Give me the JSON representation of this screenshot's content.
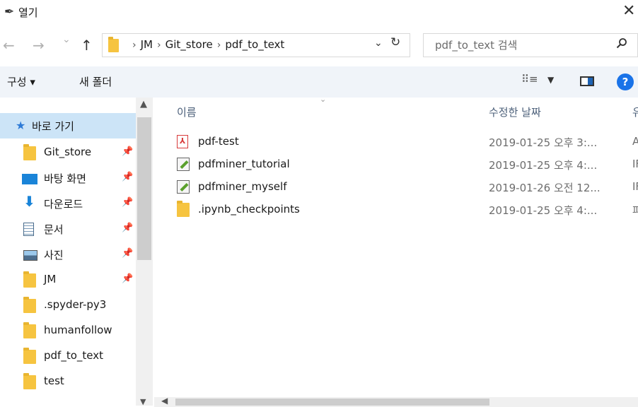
{
  "window": {
    "title": "열기",
    "close_glyph": "✕"
  },
  "nav": {
    "back_glyph": "←",
    "forward_glyph": "→",
    "recent_glyph": "⌄",
    "up_glyph": "↑",
    "breadcrumbs": [
      "JM",
      "Git_store",
      "pdf_to_text"
    ],
    "crumb_sep": "›",
    "dropdown_glyph": "⌄",
    "refresh_glyph": "↻",
    "search_placeholder": "pdf_to_text 검색",
    "search_glyph": "⚲"
  },
  "toolbar": {
    "organize_label": "구성 ▾",
    "new_folder_label": "새 폴더",
    "view_glyph": "⠿≡",
    "view_dropdown_glyph": "▼",
    "help_glyph": "?"
  },
  "sidebar": {
    "quick_access_label": "바로 가기",
    "items": [
      {
        "label": "Git_store",
        "icon": "folder-icon",
        "pinned": true
      },
      {
        "label": "바탕 화면",
        "icon": "desktop-icon",
        "pinned": true
      },
      {
        "label": "다운로드",
        "icon": "download-icon",
        "pinned": true
      },
      {
        "label": "문서",
        "icon": "document-icon",
        "pinned": true
      },
      {
        "label": "사진",
        "icon": "pictures-icon",
        "pinned": true
      },
      {
        "label": "JM",
        "icon": "folder-icon",
        "pinned": true
      },
      {
        "label": ".spyder-py3",
        "icon": "folder-icon",
        "pinned": false
      },
      {
        "label": "humanfollow",
        "icon": "folder-icon",
        "pinned": false
      },
      {
        "label": "pdf_to_text",
        "icon": "folder-icon",
        "pinned": false
      },
      {
        "label": "test",
        "icon": "folder-icon",
        "pinned": false
      }
    ],
    "pin_glyph": "✦"
  },
  "columns": {
    "name": "이름",
    "date": "수정한 날짜",
    "type": "유"
  },
  "files": [
    {
      "name": "pdf-test",
      "date": "2019-01-25 오후 3:...",
      "type": "A",
      "icon": "pdf-icon"
    },
    {
      "name": "pdfminer_tutorial",
      "date": "2019-01-25 오후 4:...",
      "type": "IF",
      "icon": "notebook-icon"
    },
    {
      "name": "pdfminer_myself",
      "date": "2019-01-26 오전 12...",
      "type": "IF",
      "icon": "notebook-icon"
    },
    {
      "name": ".ipynb_checkpoints",
      "date": "2019-01-25 오후 4:...",
      "type": "파",
      "icon": "folder-icon"
    }
  ],
  "colors": {
    "accent": "#1a73e8",
    "selection": "#cce4f7",
    "toolbar_bg": "#f0f4f9",
    "folder": "#f6c440"
  }
}
